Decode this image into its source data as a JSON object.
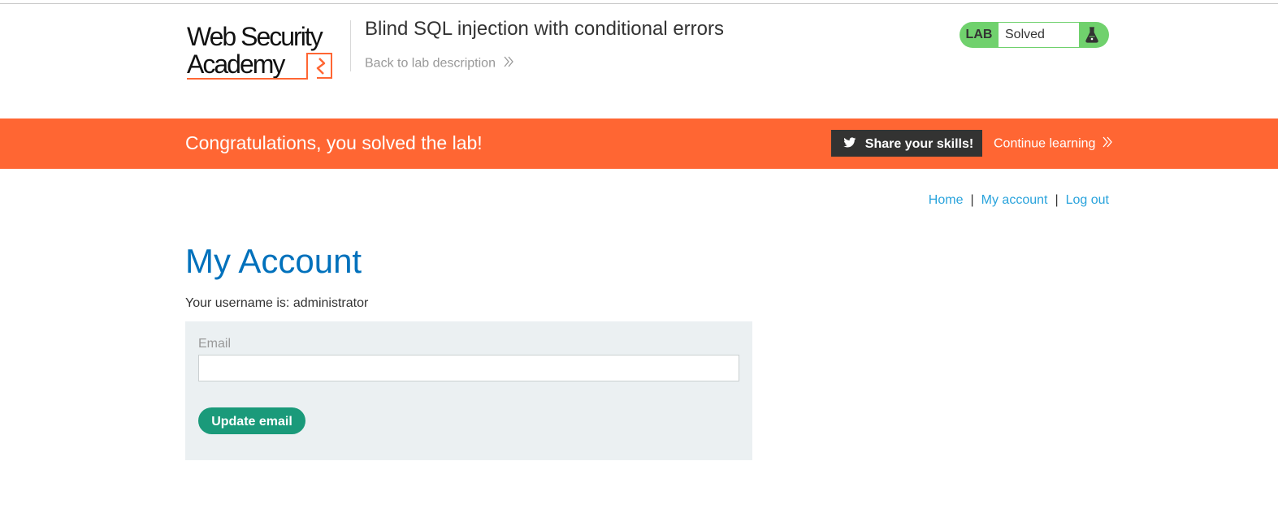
{
  "header": {
    "logo": {
      "line1": "Web Security",
      "line2": "Academy"
    },
    "lab_title": "Blind SQL injection with conditional errors",
    "back_link": "Back to lab description",
    "lab_status": {
      "label": "LAB",
      "value": "Solved",
      "icon": "flask-icon"
    }
  },
  "banner": {
    "message": "Congratulations, you solved the lab!",
    "share_button": "Share your skills!",
    "share_icon": "twitter-icon",
    "continue_link": "Continue learning"
  },
  "nav": {
    "items": [
      {
        "label": "Home"
      },
      {
        "label": "My account"
      },
      {
        "label": "Log out"
      }
    ],
    "separator": "|"
  },
  "main": {
    "title": "My Account",
    "username_text": "Your username is: administrator",
    "form": {
      "email_label": "Email",
      "email_value": "",
      "submit_label": "Update email"
    }
  },
  "colors": {
    "banner": "#ff6633",
    "lab_solved": "#70d16d",
    "link": "#29a3dc",
    "title": "#0071bc",
    "primary_button": "#1a9a7a",
    "form_background": "#ebf0f2"
  }
}
